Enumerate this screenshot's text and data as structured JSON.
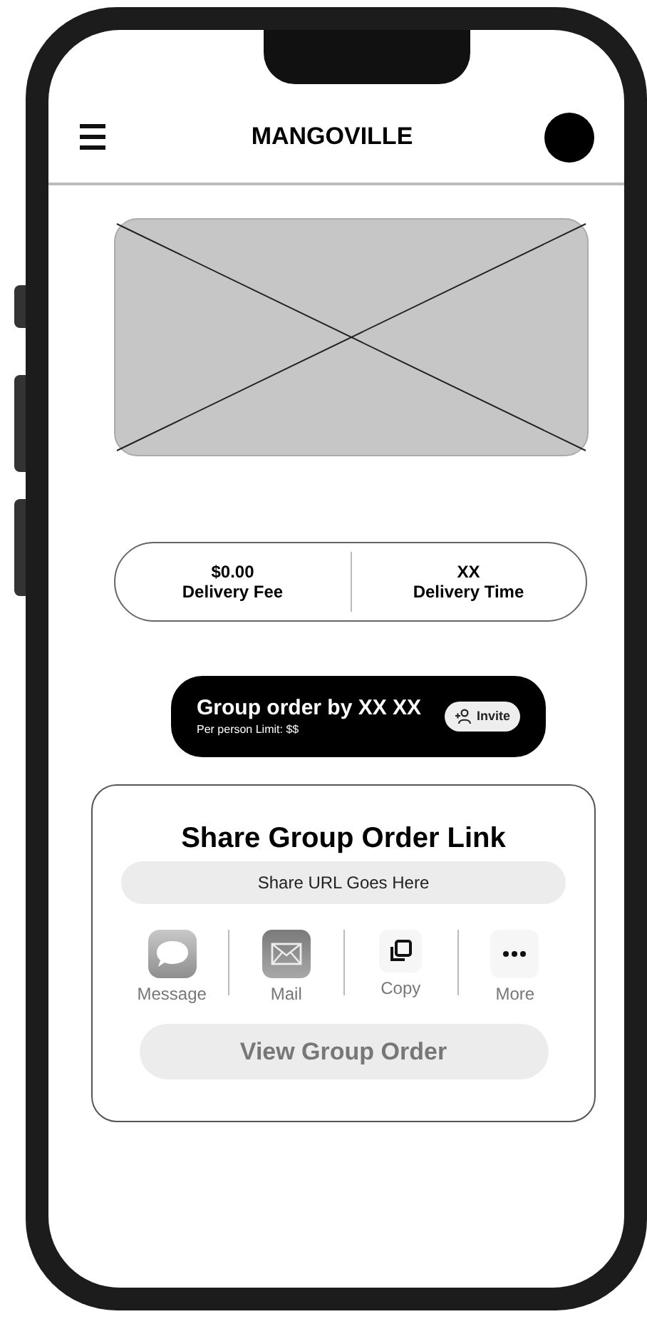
{
  "app_bar": {
    "title": "MANGOVILLE"
  },
  "delivery_info": [
    {
      "value": "$0.00",
      "label": "Delivery Fee"
    },
    {
      "value": "XX",
      "label": "Delivery Time"
    }
  ],
  "group_order": {
    "title": "Group order by XX XX",
    "subtitle": "Per person Limit: $$",
    "invite_button": "Invite"
  },
  "share_card": {
    "title": "Share Group Order Link",
    "url": "Share URL Goes Here",
    "options": [
      {
        "kind": "message",
        "label": "Message"
      },
      {
        "kind": "mail",
        "label": "Mail"
      },
      {
        "kind": "copy",
        "label": "Copy"
      },
      {
        "kind": "more",
        "label": "More"
      }
    ],
    "view_button": "View Group Order"
  }
}
